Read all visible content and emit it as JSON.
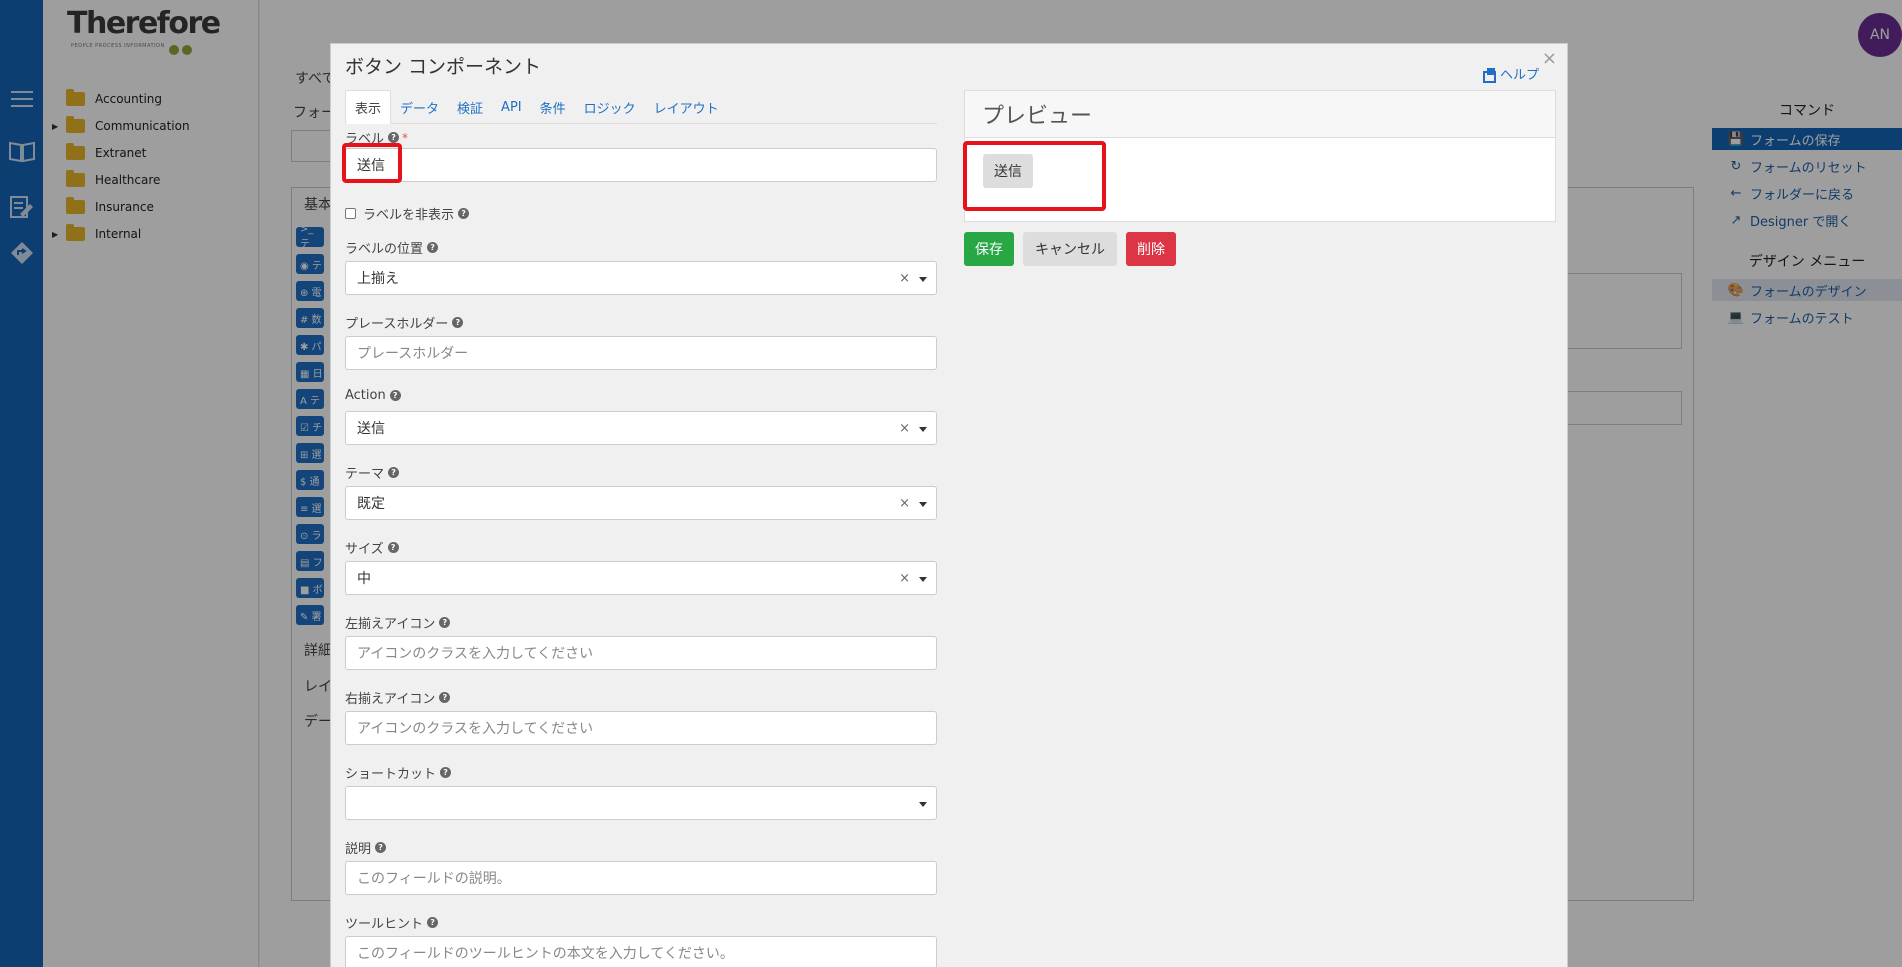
{
  "sidebar": {
    "logo_text": "Therefore",
    "logo_tagline": "PEOPLE PROCESS INFORMATION",
    "folders": [
      {
        "label": "Accounting",
        "expandable": false
      },
      {
        "label": "Communication",
        "expandable": true
      },
      {
        "label": "Extranet",
        "expandable": false
      },
      {
        "label": "Healthcare",
        "expandable": false
      },
      {
        "label": "Insurance",
        "expandable": false
      },
      {
        "label": "Internal",
        "expandable": true
      }
    ]
  },
  "background": {
    "text_1": "すべて",
    "text_2": "フォー",
    "section_basic": "基本",
    "section_detail": "詳細",
    "section_layout": "レイ",
    "section_data": "デー",
    "component_badges": [
      ">_ テ",
      "◉ テ",
      "⊕ 電",
      "# 数",
      "✱ パ",
      "▦ 日",
      "A テ",
      "☑ チ",
      "⊞ 選",
      "$ 通",
      "≡ 選",
      "⊙ ラ",
      "▤ フ",
      "■ ボ",
      "✎ 署"
    ]
  },
  "right_panel": {
    "commands_title": "コマンド",
    "commands": [
      {
        "label": "フォームの保存",
        "icon": "save-icon",
        "active": true
      },
      {
        "label": "フォームのリセット",
        "icon": "reset-icon",
        "active": false
      },
      {
        "label": "フォルダーに戻る",
        "icon": "back-arrow-icon",
        "active": false
      },
      {
        "label": "Designer で開く",
        "icon": "external-link-icon",
        "active": false
      }
    ],
    "design_menu_title": "デザイン メニュー",
    "design_items": [
      {
        "label": "フォームのデザイン",
        "icon": "palette-icon",
        "active": false
      },
      {
        "label": "フォームのテスト",
        "icon": "laptop-icon",
        "active": false
      }
    ]
  },
  "user": {
    "initials": "AN",
    "color": "#6a2c91"
  },
  "modal": {
    "title": "ボタン コンポーネント",
    "help_label": "ヘルプ",
    "close_label": "×",
    "tabs": [
      "表示",
      "データ",
      "検証",
      "API",
      "条件",
      "ロジック",
      "レイアウト"
    ],
    "active_tab": "表示",
    "fields": {
      "label_label": "ラベル",
      "label_required": "*",
      "label_value": "送信",
      "hide_label": "ラベルを非表示",
      "label_position_label": "ラベルの位置",
      "label_position_value": "上揃え",
      "placeholder_label": "プレースホルダー",
      "placeholder_placeholder": "プレースホルダー",
      "action_label": "Action",
      "action_value": "送信",
      "theme_label": "テーマ",
      "theme_value": "既定",
      "size_label": "サイズ",
      "size_value": "中",
      "left_icon_label": "左揃えアイコン",
      "left_icon_placeholder": "アイコンのクラスを入力してください",
      "right_icon_label": "右揃えアイコン",
      "right_icon_placeholder": "アイコンのクラスを入力してください",
      "shortcut_label": "ショートカット",
      "shortcut_value": "",
      "description_label": "説明",
      "description_placeholder": "このフィールドの説明。",
      "tooltip_label": "ツールヒント",
      "tooltip_placeholder": "このフィールドのツールヒントの本文を入力してください。"
    },
    "select_clear": "×",
    "preview": {
      "title": "プレビュー",
      "button_label": "送信"
    },
    "actions": {
      "save": "保存",
      "cancel": "キャンセル",
      "delete": "削除"
    }
  },
  "colors": {
    "brand_blue": "#1565b8",
    "highlight_red": "#e8121b",
    "save_green": "#28a745",
    "delete_red": "#dc3545"
  }
}
